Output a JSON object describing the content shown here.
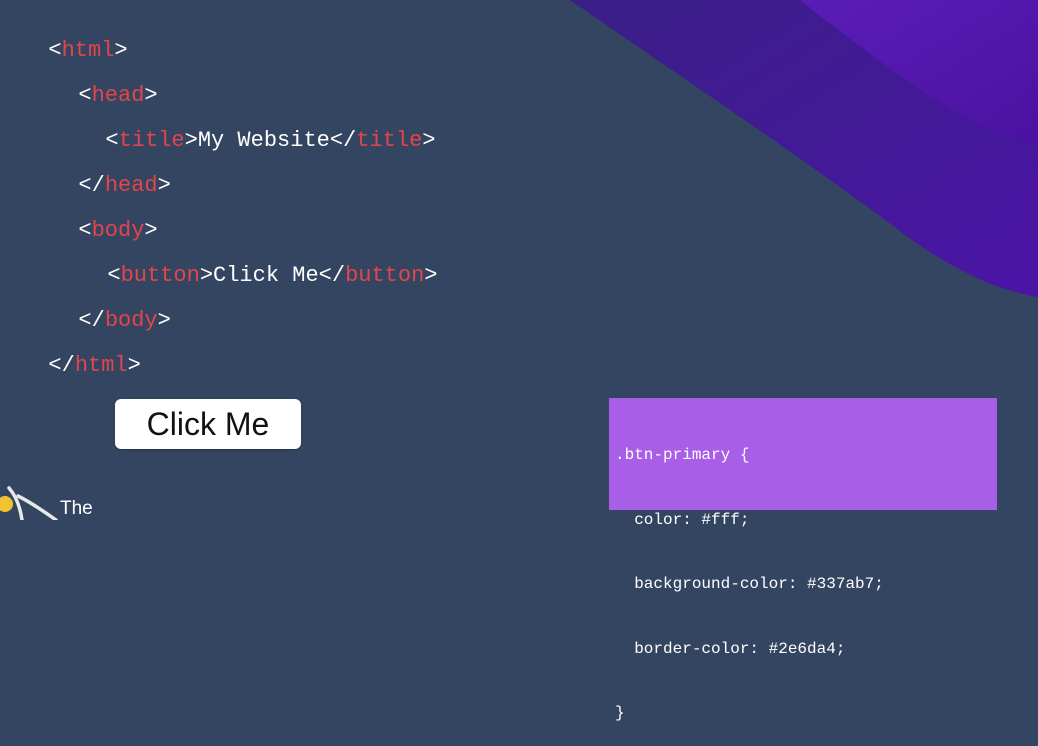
{
  "code_lines": [
    {
      "open": "<",
      "tag": "html",
      "close": ">",
      "text": ""
    },
    {
      "open": "<",
      "tag": "head",
      "close": ">",
      "text": ""
    },
    {
      "open": "<",
      "tag": "title",
      "close": ">",
      "text": "My Website",
      "end_open": "</",
      "end_tag": "title",
      "end_close": ">"
    },
    {
      "open": "</",
      "tag": "head",
      "close": ">",
      "text": ""
    },
    {
      "open": "<",
      "tag": "body",
      "close": ">",
      "text": ""
    },
    {
      "open": "<",
      "tag": "button",
      "close": ">",
      "text": "Click Me",
      "end_open": "</",
      "end_tag": "button",
      "end_close": ">"
    },
    {
      "open": "</",
      "tag": "body",
      "close": ">",
      "text": ""
    },
    {
      "open": "</",
      "tag": "html",
      "close": ">",
      "text": ""
    }
  ],
  "demo_button": {
    "label": "Click Me"
  },
  "css_snippet": {
    "lines": [
      ".btn-primary {",
      "  color: #fff;",
      "  background-color: #337ab7;",
      "  border-color: #2e6da4;",
      "}"
    ]
  },
  "logo": {
    "text": "The",
    "icon": "logo-icon"
  },
  "colors": {
    "background": "#334560",
    "tag": "#e2454c",
    "text": "#ffffff",
    "purple_wave": "#4a1a9e",
    "css_box": "#a85ee6"
  }
}
